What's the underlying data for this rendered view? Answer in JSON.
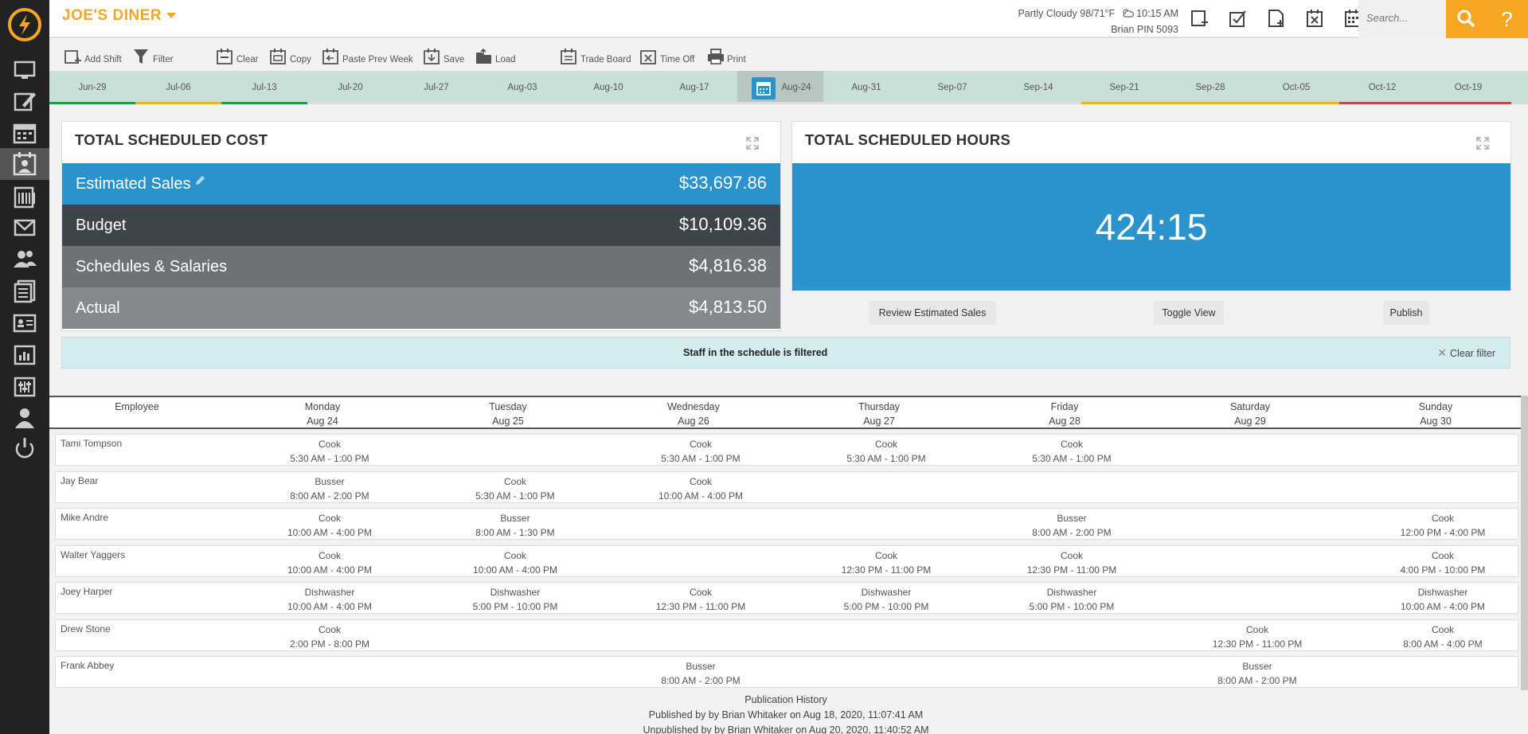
{
  "header": {
    "restaurant": "JOE'S DINER",
    "weather": "Partly Cloudy 98/71°F",
    "time": "10:15 AM",
    "user": "Brian PIN 5093",
    "search_placeholder": "Search...",
    "help": "?"
  },
  "colors": {
    "accent": "#f5a623",
    "blue": "#2a93cb",
    "sidebar": "#222222"
  },
  "toolbar": {
    "add_shift": "Add Shift",
    "filter": "Filter",
    "clear": "Clear",
    "copy": "Copy",
    "paste_prev_week": "Paste Prev Week",
    "save": "Save",
    "load": "Load",
    "trade_board": "Trade Board",
    "time_off": "Time Off",
    "print": "Print"
  },
  "weeks": [
    "Jun-29",
    "Jul-06",
    "Jul-13",
    "Jul-20",
    "Jul-27",
    "Aug-03",
    "Aug-10",
    "Aug-17",
    "Aug-24",
    "Aug-31",
    "Sep-07",
    "Sep-14",
    "Sep-21",
    "Sep-28",
    "Oct-05",
    "Oct-12",
    "Oct-19"
  ],
  "selected_week": "Aug-24",
  "cost_panel": {
    "title": "TOTAL SCHEDULED COST",
    "rows": [
      {
        "label": "Estimated Sales",
        "value": "$33,697.86"
      },
      {
        "label": "Budget",
        "value": "$10,109.36"
      },
      {
        "label": "Schedules & Salaries",
        "value": "$4,816.38"
      },
      {
        "label": "Actual",
        "value": "$4,813.50"
      }
    ]
  },
  "hours_panel": {
    "title": "TOTAL SCHEDULED HOURS",
    "value": "424:15"
  },
  "actions": {
    "review": "Review Estimated Sales",
    "toggle": "Toggle View",
    "publish": "Publish"
  },
  "filter_notice": {
    "message": "Staff in the schedule is filtered",
    "clear": "Clear filter"
  },
  "schedule": {
    "columns": [
      {
        "day": "Employee",
        "date": ""
      },
      {
        "day": "Monday",
        "date": "Aug 24"
      },
      {
        "day": "Tuesday",
        "date": "Aug 25"
      },
      {
        "day": "Wednesday",
        "date": "Aug 26"
      },
      {
        "day": "Thursday",
        "date": "Aug 27"
      },
      {
        "day": "Friday",
        "date": "Aug 28"
      },
      {
        "day": "Saturday",
        "date": "Aug 29"
      },
      {
        "day": "Sunday",
        "date": "Aug 30"
      }
    ],
    "rows": [
      {
        "name": "Tami Tompson",
        "shifts": [
          {
            "role": "Cook",
            "time": "5:30 AM - 1:00 PM"
          },
          null,
          {
            "role": "Cook",
            "time": "5:30 AM - 1:00 PM"
          },
          {
            "role": "Cook",
            "time": "5:30 AM - 1:00 PM"
          },
          {
            "role": "Cook",
            "time": "5:30 AM - 1:00 PM"
          },
          null,
          null
        ]
      },
      {
        "name": "Jay Bear",
        "shifts": [
          {
            "role": "Busser",
            "time": "8:00 AM - 2:00 PM"
          },
          {
            "role": "Cook",
            "time": "5:30 AM - 1:00 PM"
          },
          {
            "role": "Cook",
            "time": "10:00 AM - 4:00 PM"
          },
          null,
          null,
          null,
          null
        ]
      },
      {
        "name": "Mike Andre",
        "shifts": [
          {
            "role": "Cook",
            "time": "10:00 AM - 4:00 PM"
          },
          {
            "role": "Busser",
            "time": "8:00 AM - 1:30 PM"
          },
          null,
          null,
          {
            "role": "Busser",
            "time": "8:00 AM - 2:00 PM"
          },
          null,
          {
            "role": "Cook",
            "time": "12:00 PM - 4:00 PM"
          }
        ]
      },
      {
        "name": "Walter Yaggers",
        "shifts": [
          {
            "role": "Cook",
            "time": "10:00 AM - 4:00 PM"
          },
          {
            "role": "Cook",
            "time": "10:00 AM - 4:00 PM"
          },
          null,
          {
            "role": "Cook",
            "time": "12:30 PM - 11:00 PM"
          },
          {
            "role": "Cook",
            "time": "12:30 PM - 11:00 PM"
          },
          null,
          {
            "role": "Cook",
            "time": "4:00 PM - 10:00 PM"
          }
        ]
      },
      {
        "name": "Joey Harper",
        "shifts": [
          {
            "role": "Dishwasher",
            "time": "10:00 AM - 4:00 PM"
          },
          {
            "role": "Dishwasher",
            "time": "5:00 PM - 10:00 PM"
          },
          {
            "role": "Cook",
            "time": "12:30 PM - 11:00 PM"
          },
          {
            "role": "Dishwasher",
            "time": "5:00 PM - 10:00 PM"
          },
          {
            "role": "Dishwasher",
            "time": "5:00 PM - 10:00 PM"
          },
          null,
          {
            "role": "Dishwasher",
            "time": "10:00 AM - 4:00 PM"
          }
        ]
      },
      {
        "name": "Drew Stone",
        "shifts": [
          {
            "role": "Cook",
            "time": "2:00 PM - 8:00 PM"
          },
          null,
          null,
          null,
          null,
          {
            "role": "Cook",
            "time": "12:30 PM - 11:00 PM"
          },
          {
            "role": "Cook",
            "time": "8:00 AM - 4:00 PM"
          }
        ]
      },
      {
        "name": "Frank Abbey",
        "shifts": [
          null,
          null,
          {
            "role": "Busser",
            "time": "8:00 AM - 2:00 PM"
          },
          null,
          null,
          {
            "role": "Busser",
            "time": "8:00 AM - 2:00 PM"
          },
          null
        ]
      }
    ]
  },
  "publication": {
    "title": "Publication History",
    "published": "Published by by Brian Whitaker on Aug 18, 2020, 11:07:41 AM",
    "unpublished": "Unpublished by by Brian Whitaker on Aug 20, 2020, 11:40:52 AM"
  }
}
